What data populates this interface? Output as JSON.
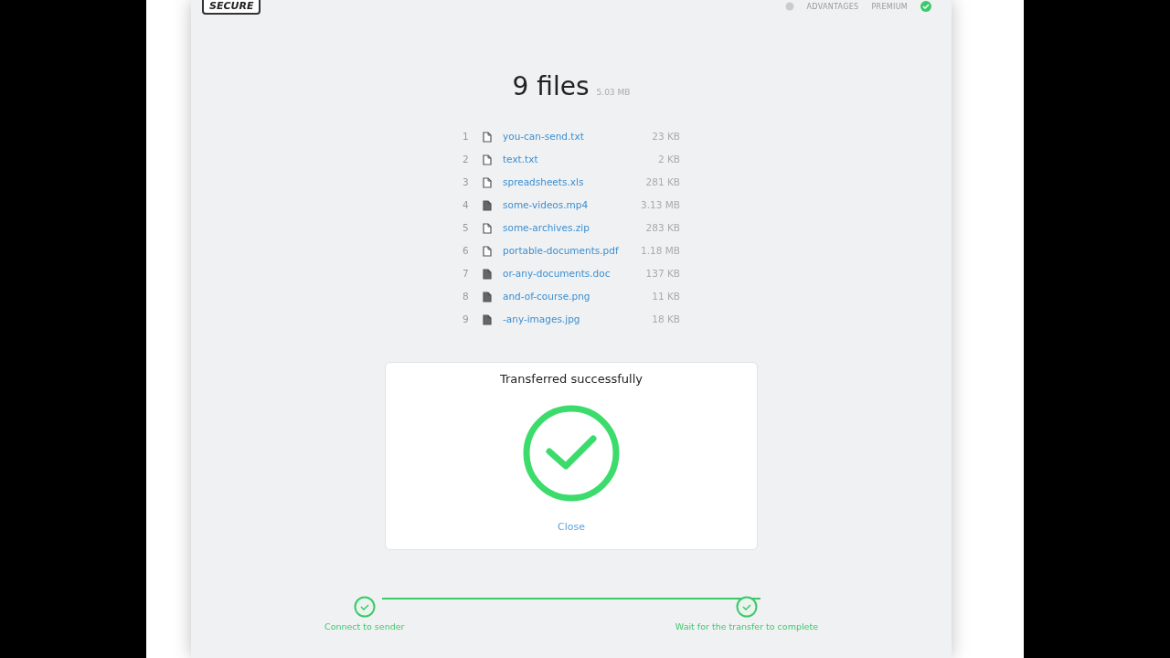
{
  "header": {
    "logo": "SECURE",
    "nav": [
      "ADVANTAGES",
      "PREMIUM"
    ],
    "verified": true
  },
  "summary": {
    "title": "9 files",
    "size": "5.03 MB"
  },
  "files": [
    {
      "index": "1",
      "name": "you-can-send.txt",
      "size": "23 KB",
      "kind": "text"
    },
    {
      "index": "2",
      "name": "text.txt",
      "size": "2 KB",
      "kind": "text"
    },
    {
      "index": "3",
      "name": "spreadsheets.xls",
      "size": "281 KB",
      "kind": "sheet"
    },
    {
      "index": "4",
      "name": "some-videos.mp4",
      "size": "3.13 MB",
      "kind": "video"
    },
    {
      "index": "5",
      "name": "some-archives.zip",
      "size": "283 KB",
      "kind": "archive"
    },
    {
      "index": "6",
      "name": "portable-documents.pdf",
      "size": "1.18 MB",
      "kind": "pdf"
    },
    {
      "index": "7",
      "name": "or-any-documents.doc",
      "size": "137 KB",
      "kind": "doc"
    },
    {
      "index": "8",
      "name": "and-of-course.png",
      "size": "11 KB",
      "kind": "image"
    },
    {
      "index": "9",
      "name": "-any-images.jpg",
      "size": "18 KB",
      "kind": "image"
    }
  ],
  "dialog": {
    "title": "Transferred successfully",
    "success": true,
    "link": "Close"
  },
  "steps": [
    {
      "label": "Connect to sender",
      "done": true
    },
    {
      "label": "Wait for the transfer to complete",
      "done": true
    }
  ]
}
